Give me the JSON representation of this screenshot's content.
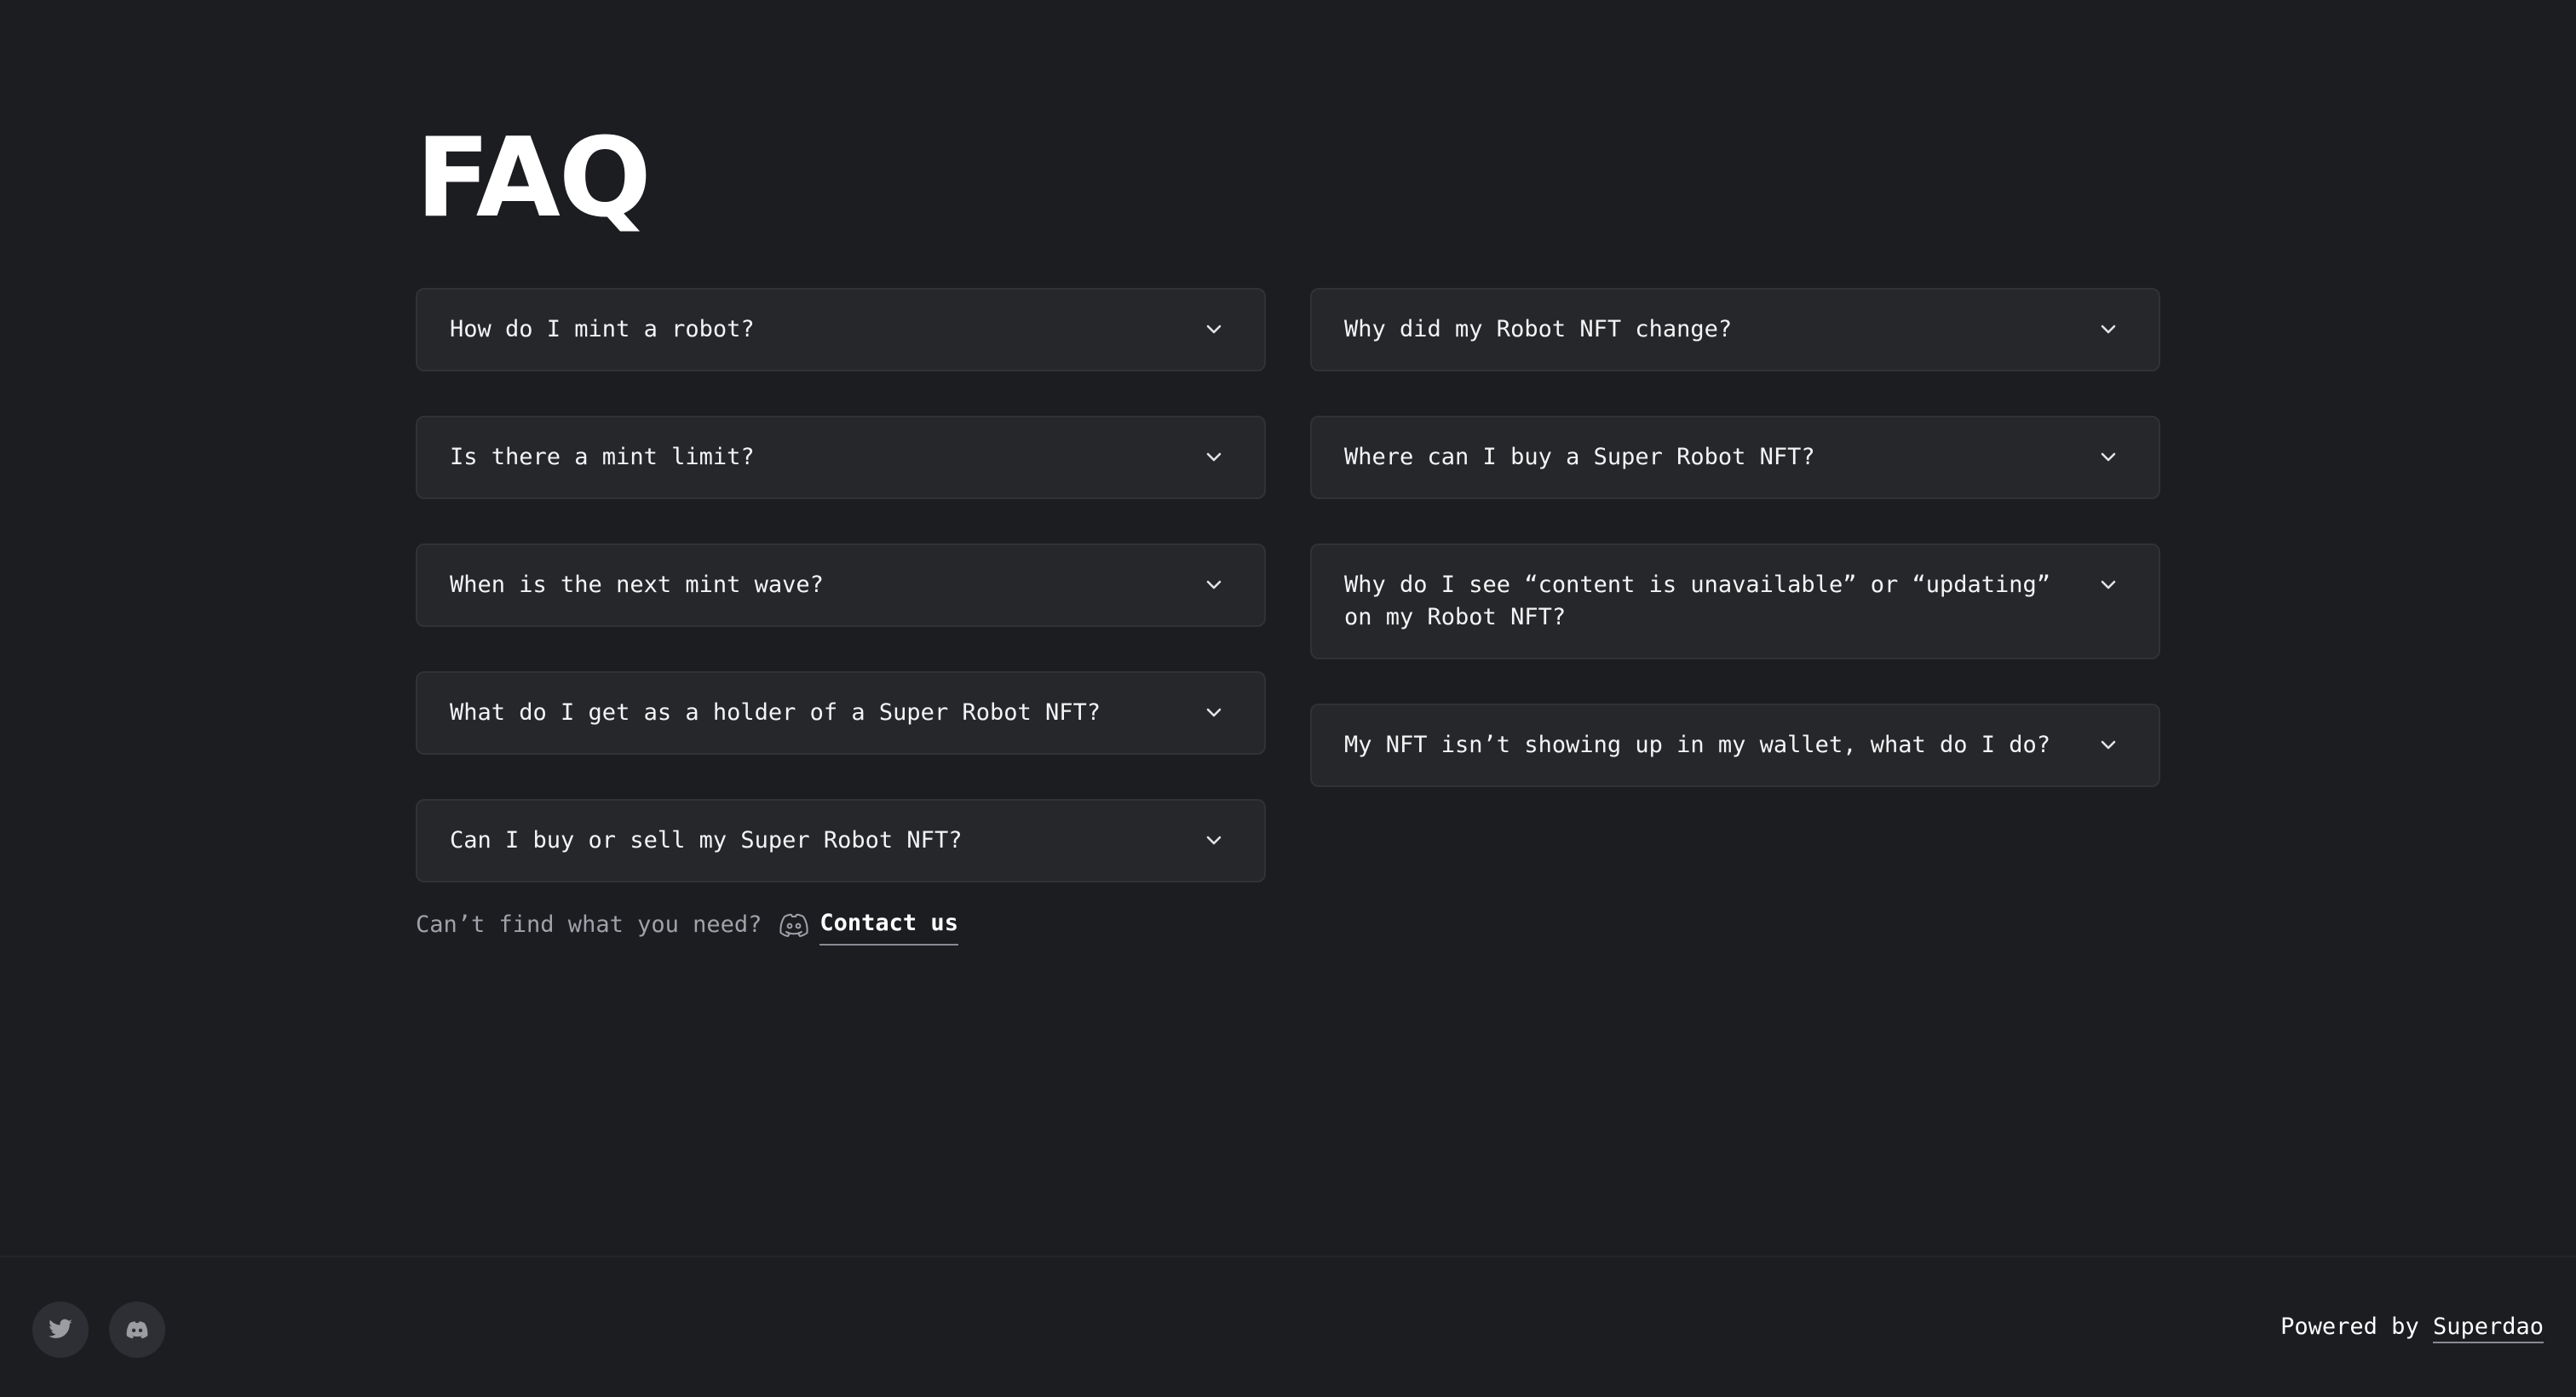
{
  "page": {
    "title": "FAQ"
  },
  "faq": {
    "left": [
      {
        "question": "How do I mint a robot?"
      },
      {
        "question": "Is there a mint limit?"
      },
      {
        "question": "When is the next mint wave?"
      },
      {
        "question": "What do I get as a holder of a Super Robot NFT?"
      },
      {
        "question": "Can I buy or sell my Super Robot NFT?"
      }
    ],
    "right": [
      {
        "question": "Why did my Robot NFT change?"
      },
      {
        "question": "Where can I buy a Super Robot NFT?"
      },
      {
        "question": "Why do I see “content is unavailable” or “updating” on my Robot NFT?"
      },
      {
        "question": "My NFT isn’t showing up in my wallet, what do I do?"
      }
    ],
    "expand_icon": "chevron-down-icon"
  },
  "contact": {
    "prompt": "Can’t find what you need?",
    "icon": "discord-icon",
    "link_label": "Contact us"
  },
  "footer": {
    "social": [
      {
        "icon": "twitter-icon"
      },
      {
        "icon": "discord-icon"
      }
    ],
    "powered_prefix": "Powered by",
    "powered_link": "Superdao"
  },
  "colors": {
    "background": "#1c1d21",
    "card": "#26272b",
    "card_border": "#313236",
    "text": "#ffffff",
    "muted_text": "#a1a1aa",
    "social_bg": "#2e2f34"
  }
}
